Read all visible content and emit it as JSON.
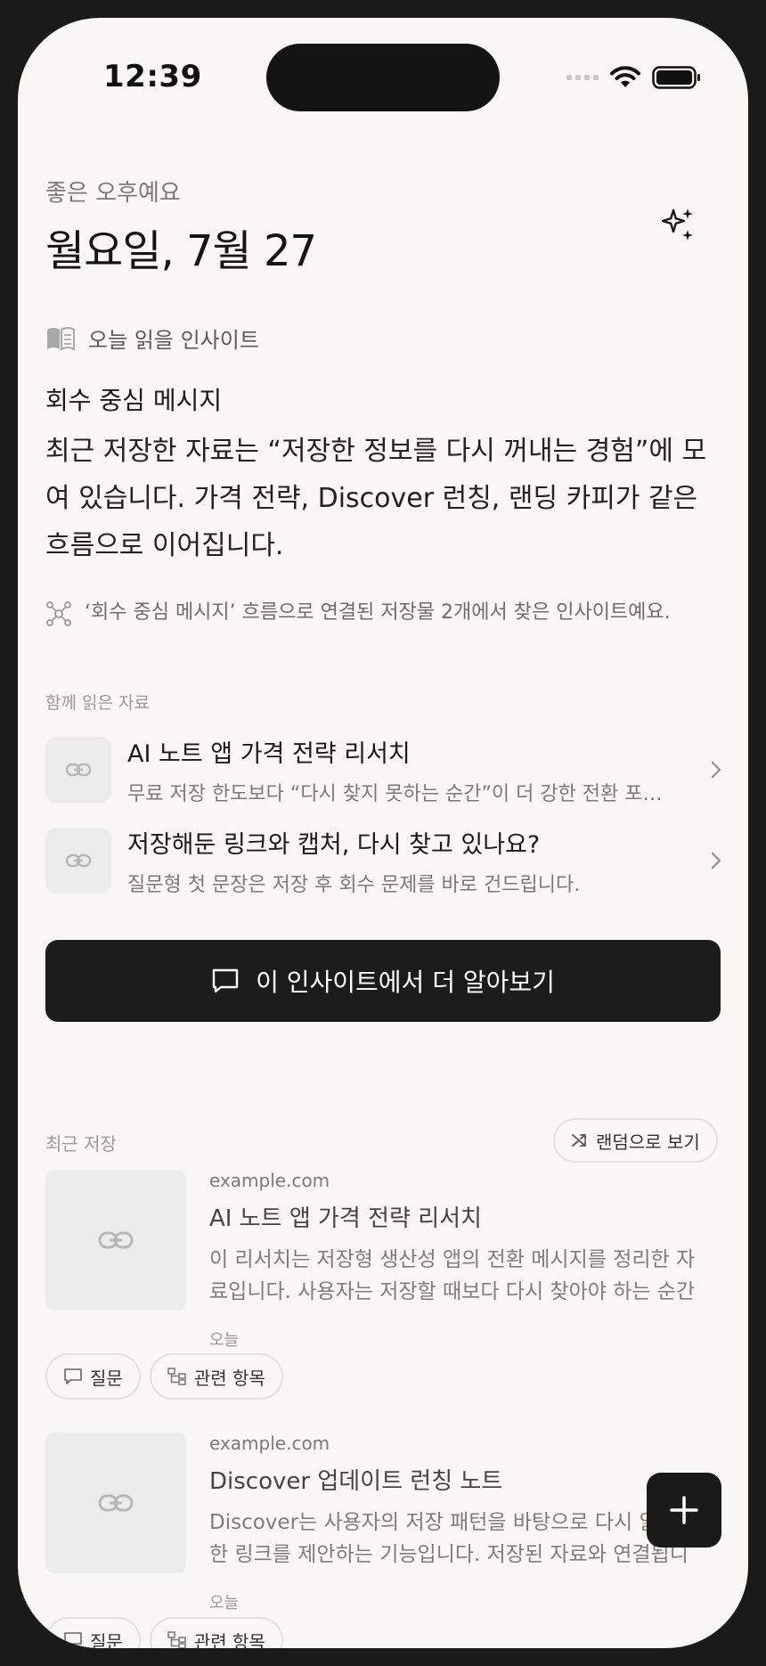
{
  "status_bar": {
    "time": "12:39"
  },
  "header": {
    "greeting": "좋은 오후예요",
    "date": "월요일, 7월 27",
    "sparkle_icon": "sparkles-icon"
  },
  "insight": {
    "section_title": "오늘 읽을 인사이트",
    "title": "회수 중심 메시지",
    "body": "최근 저장한 자료는 “저장한 정보를 다시 꺼내는 경험”에 모여 있습니다. 가격 전략, Discover 런칭, 랜딩 카피가 같은 흐름으로 이어집니다.",
    "flow_note": "‘회수 중심 메시지’ 흐름으로 연결된 저장물 2개에서 찾은 인사이트예요.",
    "related_label": "함께 읽은 자료",
    "related": [
      {
        "title": "AI 노트 앱 가격 전략 리서치",
        "subtitle": "무료 저장 한도보다 “다시 찾지 못하는 순간”이 더 강한 전환 포인트입니다."
      },
      {
        "title": "저장해둔 링크와 캡처, 다시 찾고 있나요?",
        "subtitle": "질문형 첫 문장은 저장 후 회수 문제를 바로 건드립니다."
      }
    ],
    "cta_label": "이 인사이트에서 더 알아보기"
  },
  "recent": {
    "label": "최근 저장",
    "random_label": "랜덤으로 보기",
    "items": [
      {
        "domain": "example.com",
        "title": "AI 노트 앱 가격 전략 리서치",
        "description": "이 리서치는 저장형 생산성 앱의 전환 메시지를 정리한 자료입니다. 사용자는 저장할 때보다 다시 찾아야 하는 순간에 가치를 느낍니다.",
        "date": "오늘",
        "ask_label": "질문",
        "related_label": "관련 항목"
      },
      {
        "domain": "example.com",
        "title": "Discover 업데이트 런칭 노트",
        "description": "Discover는 사용자의 저장 패턴을 바탕으로 다시 읽을 만한 링크를 제안하는 기능입니다. 저장된 자료와 연결됩니다.",
        "date": "오늘",
        "ask_label": "질문",
        "related_label": "관련 항목"
      }
    ]
  },
  "fab": {
    "icon": "plus-icon"
  }
}
